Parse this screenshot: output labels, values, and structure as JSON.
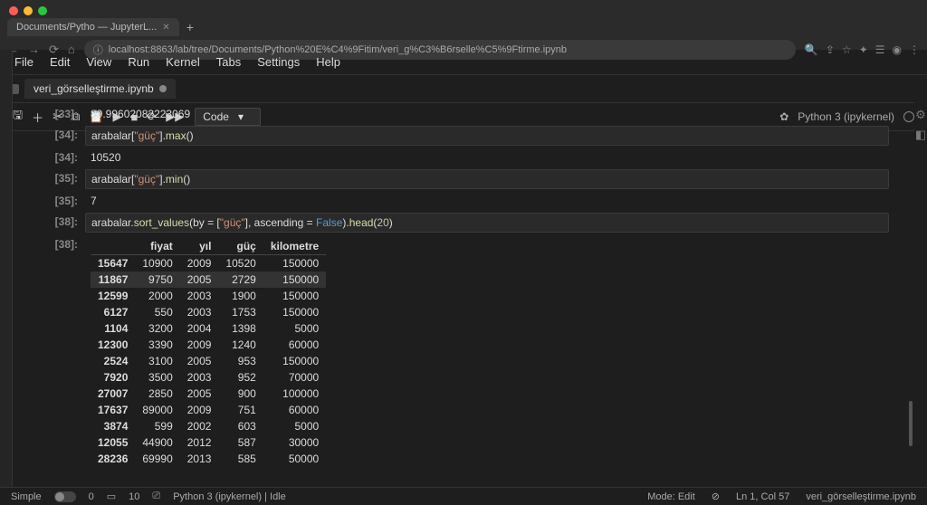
{
  "browser": {
    "tab_title": "Documents/Pytho — JupyterL...",
    "url": "localhost:8863/lab/tree/Documents/Python%20E%C4%9Fitim/veri_g%C3%B6rselle%C5%9Ftirme.ipynb"
  },
  "menu": [
    "File",
    "Edit",
    "View",
    "Run",
    "Kernel",
    "Tabs",
    "Settings",
    "Help"
  ],
  "file_tab": "veri_görselleştirme.ipynb",
  "cell_type": "Code",
  "kernel_name": "Python 3 (ipykernel)",
  "cells": {
    "c33_out": "89.99602082223069",
    "c34_in_pre": "arabalar[",
    "c34_in_str": "\"güç\"",
    "c34_in_mid": "].",
    "c34_in_func": "max",
    "c34_in_post": "()",
    "c34_out": "10520",
    "c35_in_pre": "arabalar[",
    "c35_in_str": "\"güç\"",
    "c35_in_mid": "].",
    "c35_in_func": "min",
    "c35_in_post": "()",
    "c35_out": "7",
    "c38_in_a": "arabalar.",
    "c38_in_b": "sort_values",
    "c38_in_c": "(by = [",
    "c38_in_d": "\"güç\"",
    "c38_in_e": "], ascending = ",
    "c38_in_f": "False",
    "c38_in_g": ").",
    "c38_in_h": "head",
    "c38_in_i": "(",
    "c38_in_j": "20",
    "c38_in_k": ")"
  },
  "prompts": {
    "p33": "[33]:",
    "p34": "[34]:",
    "p35": "[35]:",
    "p38": "[38]:"
  },
  "table": {
    "headers": [
      "",
      "fiyat",
      "yıl",
      "güç",
      "kilometre"
    ],
    "rows": [
      [
        "15647",
        "10900",
        "2009",
        "10520",
        "150000"
      ],
      [
        "11867",
        "9750",
        "2005",
        "2729",
        "150000"
      ],
      [
        "12599",
        "2000",
        "2003",
        "1900",
        "150000"
      ],
      [
        "6127",
        "550",
        "2003",
        "1753",
        "150000"
      ],
      [
        "1104",
        "3200",
        "2004",
        "1398",
        "5000"
      ],
      [
        "12300",
        "3390",
        "2009",
        "1240",
        "60000"
      ],
      [
        "2524",
        "3100",
        "2005",
        "953",
        "150000"
      ],
      [
        "7920",
        "3500",
        "2003",
        "952",
        "70000"
      ],
      [
        "27007",
        "2850",
        "2005",
        "900",
        "100000"
      ],
      [
        "17637",
        "89000",
        "2009",
        "751",
        "60000"
      ],
      [
        "3874",
        "599",
        "2002",
        "603",
        "5000"
      ],
      [
        "12055",
        "44900",
        "2012",
        "587",
        "30000"
      ],
      [
        "28236",
        "69990",
        "2013",
        "585",
        "50000"
      ]
    ],
    "highlight_row": 1
  },
  "status": {
    "left1": "Simple",
    "counts_a": "0",
    "counts_b": "10",
    "kernel": "Python 3 (ipykernel) | Idle",
    "mode": "Mode: Edit",
    "pos": "Ln 1, Col 57",
    "file": "veri_görselleştirme.ipynb"
  }
}
